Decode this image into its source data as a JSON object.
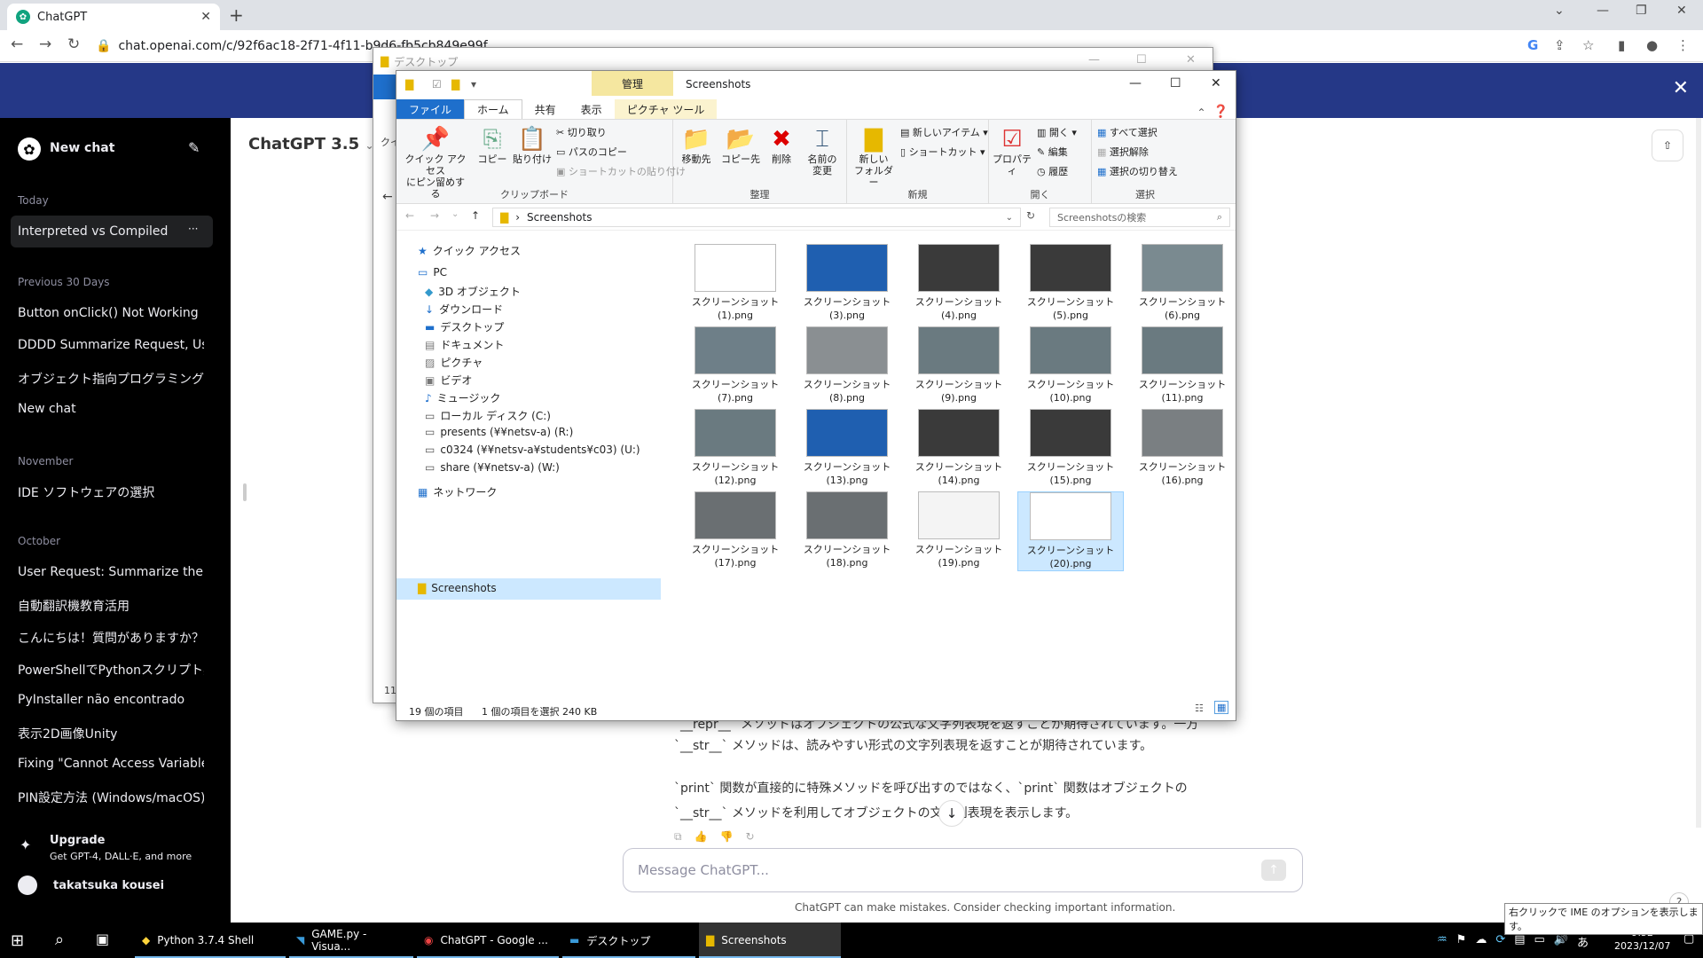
{
  "browser": {
    "tab_title": "ChatGPT",
    "url": "chat.openai.com/c/92f6ac18-2f71-4f11-b9d6-fb5cb849e99f"
  },
  "sidebar": {
    "new_chat": "New chat",
    "sections": [
      {
        "header": "Today",
        "items": [
          "Interpreted vs Compiled"
        ]
      },
      {
        "header": "Previous 30 Days",
        "items": [
          "Button onClick() Not Working",
          "DDDD Summarize Request, User",
          "オブジェクト指向プログラミング概要",
          "New chat"
        ]
      },
      {
        "header": "November",
        "items": [
          "IDE ソフトウェアの選択"
        ]
      },
      {
        "header": "October",
        "items": [
          "User Request: Summarize the abo",
          "自動翻訳機教育活用",
          "こんにちは！質問がありますか？",
          "PowerShellでPythonスクリプト実行",
          "PyInstaller não encontrado",
          "表示2D画像Unity",
          "Fixing \"Cannot Access Variable\"",
          "PIN設定方法 (Windows/macOS)"
        ]
      }
    ],
    "upgrade_title": "Upgrade",
    "upgrade_sub": "Get GPT-4, DALL·E, and more",
    "user": "takatsuka kousei"
  },
  "main": {
    "model": "ChatGPT 3.5",
    "lines": [
      "`__repr__` メソッドはオブジェクトの公式な文字列表現を返すことが期待されています。一方",
      "`__str__` メソッドは、読みやすい形式の文字列表現を返すことが期待されています。",
      "`print` 関数が直接的に特殊メソッドを呼び出すのではなく、`print` 関数はオブジェクトの",
      "`__str__` メソッドを利用してオブジェクトの文字列表現を表示します。"
    ],
    "input_placeholder": "Message ChatGPT...",
    "disclaimer": "ChatGPT can make mistakes. Consider checking important information."
  },
  "back_window": {
    "title": "デスクトップ",
    "side_label": "クイ",
    "count": "11"
  },
  "explorer": {
    "title": "Screenshots",
    "manage_tab": "管理",
    "tabs": [
      "ファイル",
      "ホーム",
      "共有",
      "表示",
      "ピクチャ ツール"
    ],
    "clipboard": {
      "pin": "クイック アクセス\nにピン留めする",
      "copy": "コピー",
      "paste": "貼り付け",
      "cut": "切り取り",
      "copy_path": "パスのコピー",
      "paste_shortcut": "ショートカットの貼り付け",
      "label": "クリップボード"
    },
    "organize": {
      "move": "移動先",
      "copy_to": "コピー先",
      "delete": "削除",
      "rename": "名前の\n変更",
      "label": "整理"
    },
    "new": {
      "folder": "新しい\nフォルダー",
      "new_item": "新しいアイテム ▾",
      "shortcut": "ショートカット ▾",
      "label": "新規"
    },
    "open": {
      "properties": "プロパティ",
      "open": "開く ▾",
      "edit": "編集",
      "history": "履歴",
      "label": "開く"
    },
    "select": {
      "all": "すべて選択",
      "none": "選択解除",
      "invert": "選択の切り替え",
      "label": "選択"
    },
    "path": "Screenshots",
    "search_placeholder": "Screenshotsの検索",
    "nav": [
      "クイック アクセス",
      "PC",
      "3D オブジェクト",
      "ダウンロード",
      "デスクトップ",
      "ドキュメント",
      "ピクチャ",
      "ビデオ",
      "ミュージック",
      "ローカル ディスク (C:)",
      "presents (¥¥netsv-a) (R:)",
      "c0324 (¥¥netsv-a¥students¥c03) (U:)",
      "share (¥¥netsv-a) (W:)",
      "ネットワーク",
      "Screenshots"
    ],
    "files": [
      "スクリーンショット\n(1).png",
      "スクリーンショット\n(3).png",
      "スクリーンショット\n(4).png",
      "スクリーンショット\n(5).png",
      "スクリーンショット\n(6).png",
      "スクリーンショット\n(7).png",
      "スクリーンショット\n(8).png",
      "スクリーンショット\n(9).png",
      "スクリーンショット\n(10).png",
      "スクリーンショット\n(11).png",
      "スクリーンショット\n(12).png",
      "スクリーンショット\n(13).png",
      "スクリーンショット\n(14).png",
      "スクリーンショット\n(15).png",
      "スクリーンショット\n(16).png",
      "スクリーンショット\n(17).png",
      "スクリーンショット\n(18).png",
      "スクリーンショット\n(19).png",
      "スクリーンショット\n(20).png"
    ],
    "thumb_colors": [
      "#ffffff",
      "#1f5fb0",
      "#3a3a3a",
      "#3a3a3a",
      "#7a8a90",
      "#6e7f88",
      "#8a8f92",
      "#6a7a80",
      "#6a7a80",
      "#6a7a80",
      "#6a7a80",
      "#1f5fb0",
      "#3a3a3a",
      "#3a3a3a",
      "#7a7f82",
      "#6a6f72",
      "#6a6f72",
      "#f4f4f4",
      "#ffffff"
    ],
    "item_count": "19 個の項目",
    "selected_info": "1 個の項目を選択  240 KB"
  },
  "taskbar": {
    "items": [
      "Python 3.7.4 Shell",
      "GAME.py - Visua...",
      "ChatGPT - Google ...",
      "デスクトップ",
      "Screenshots"
    ],
    "time": "9:52",
    "date": "2023/12/07",
    "ime": "あ",
    "ime_tip": "右クリックで IME のオプションを表示します。"
  }
}
